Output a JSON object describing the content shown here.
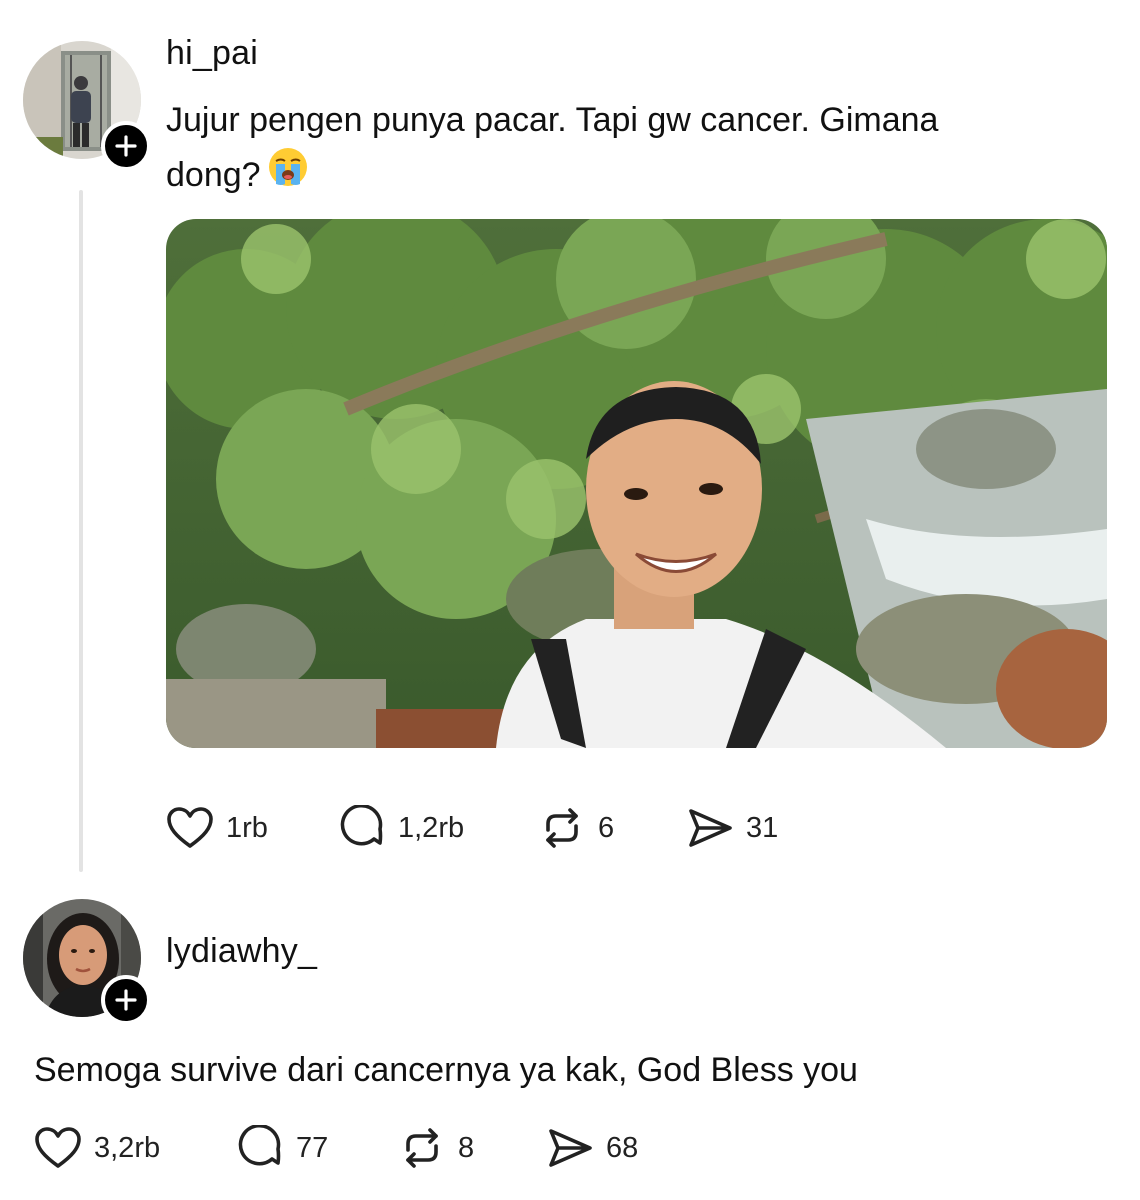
{
  "post": {
    "username": "hi_pai",
    "text_line1": "Jujur pengen punya pacar. Tapi gw cancer. Gimana",
    "text_line2": "dong?",
    "emoji": "loudly-crying-face",
    "image_description": "smiling man in bandana and white t-shirt with backpack, selfie in front of green forest and rocky stream",
    "stats": {
      "likes": "1rb",
      "replies": "1,2rb",
      "reposts": "6",
      "shares": "31"
    }
  },
  "reply": {
    "username": "lydiawhy_",
    "text": "Semoga survive dari cancernya ya kak, God Bless you",
    "stats": {
      "likes": "3,2rb",
      "replies": "77",
      "reposts": "8",
      "shares": "68"
    }
  },
  "icons": {
    "like": "heart-icon",
    "reply": "comment-bubble-icon",
    "repost": "repost-arrows-icon",
    "share": "send-paper-plane-icon",
    "follow": "plus-icon"
  },
  "colors": {
    "text": "#111111",
    "thread_line": "#e3e3e3",
    "follow_badge": "#000000"
  }
}
